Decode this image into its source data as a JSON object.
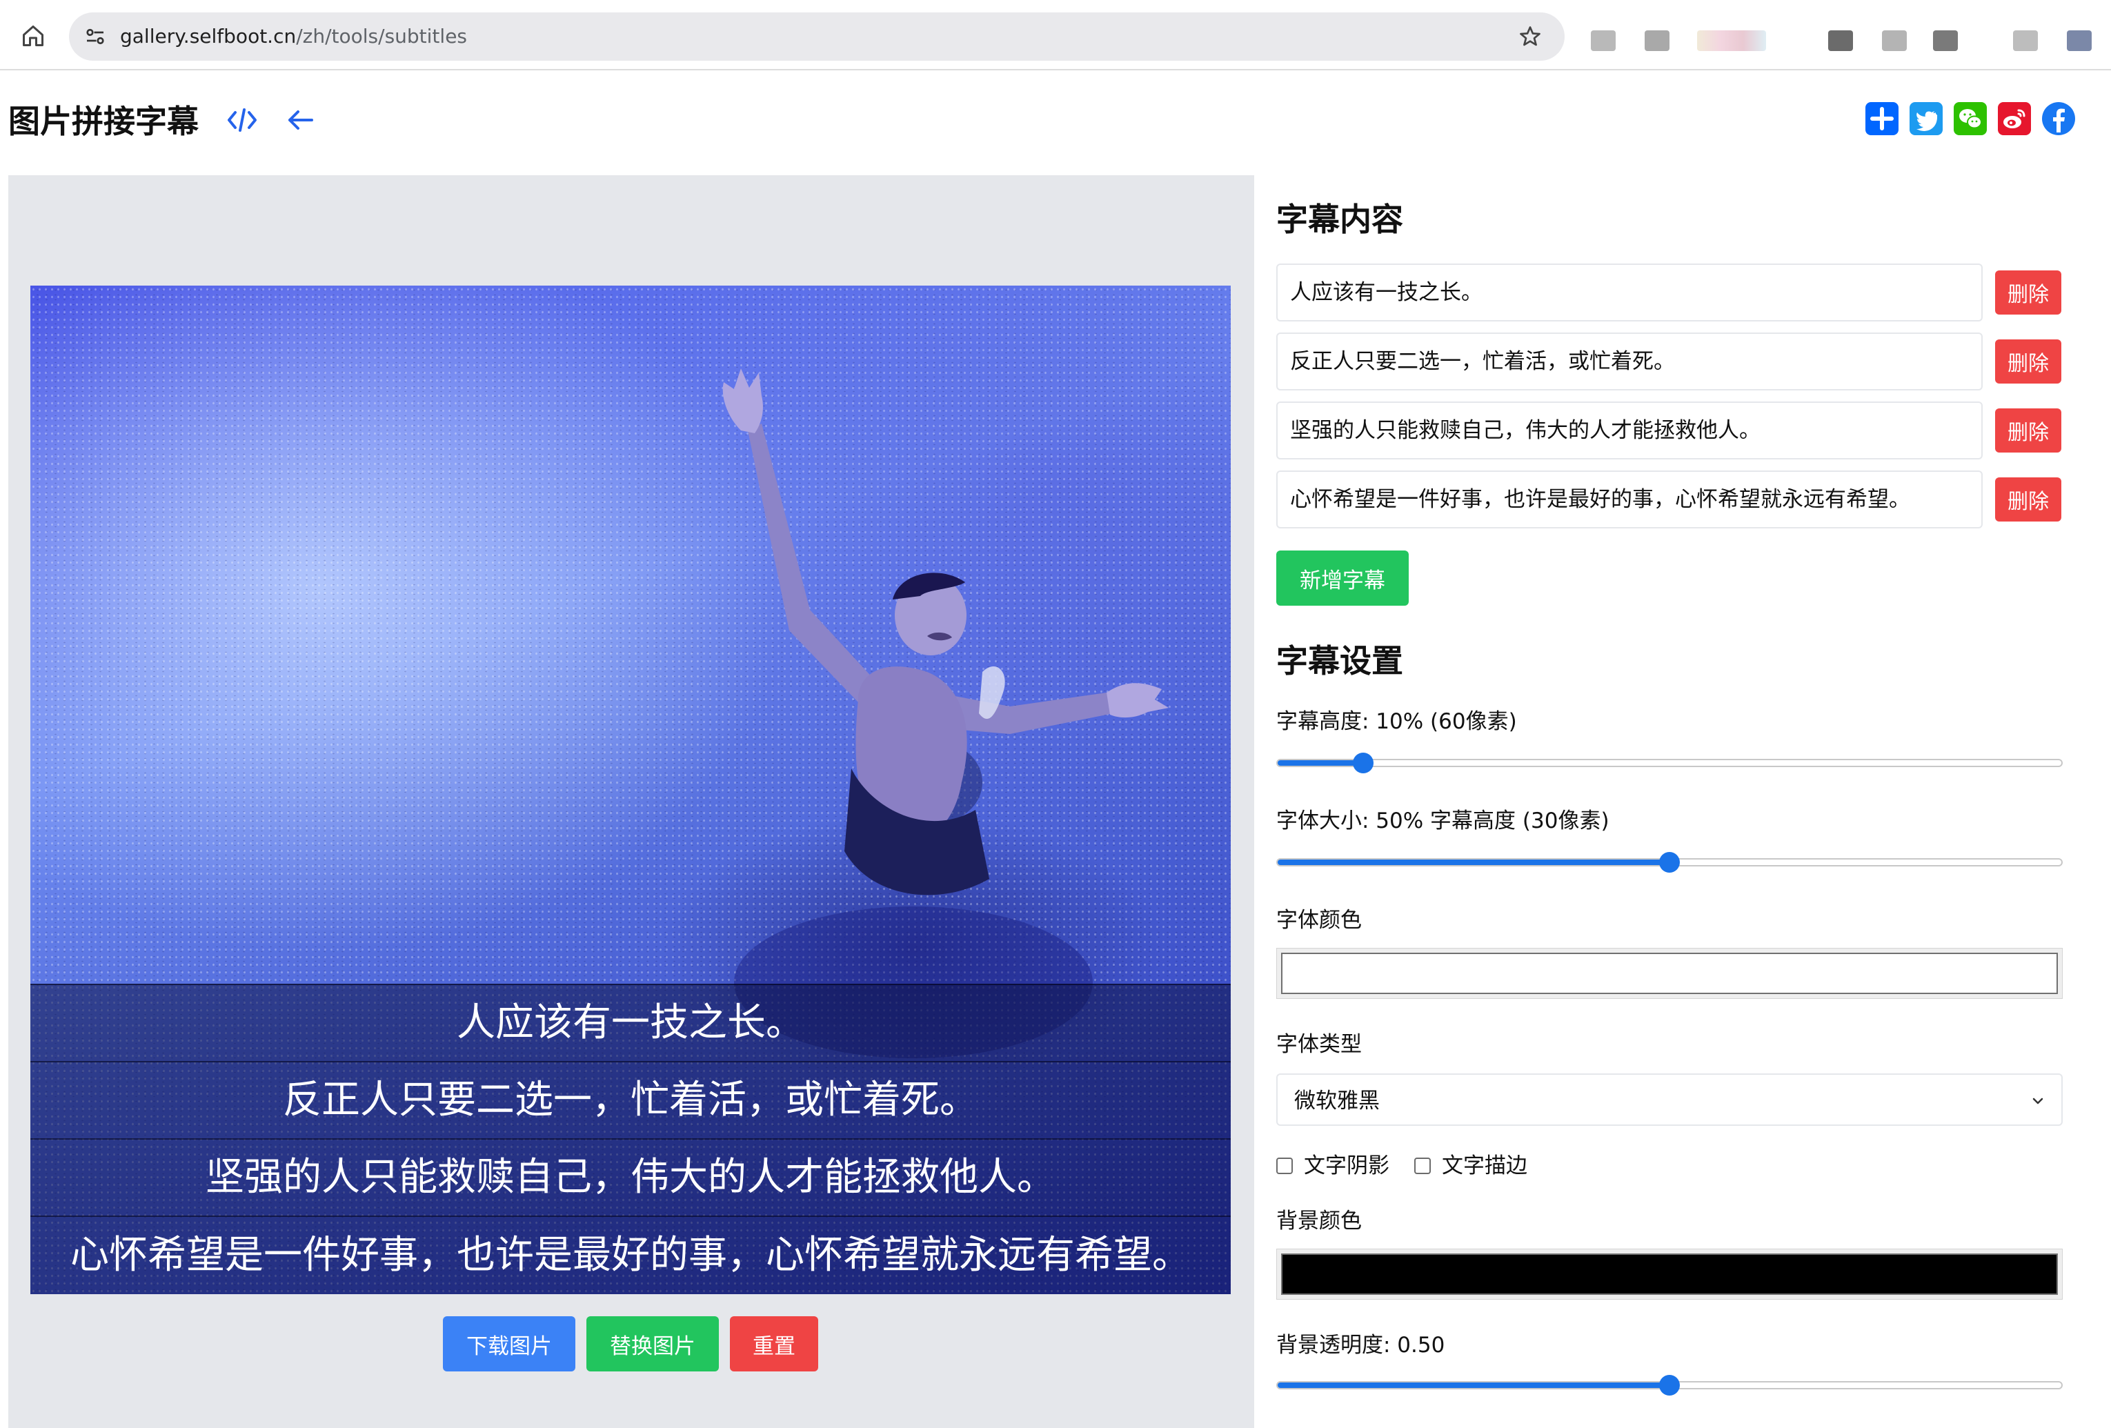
{
  "browser": {
    "url_host": "gallery.selfboot.cn",
    "url_path": "/zh/tools/subtitles"
  },
  "header": {
    "title": "图片拼接字幕"
  },
  "preview": {
    "subtitles": [
      "人应该有一技之长。",
      "反正人只要二选一，忙着活，或忙着死。",
      "坚强的人只能救赎自己，伟大的人才能拯救他人。",
      "心怀希望是一件好事，也许是最好的事，心怀希望就永远有希望。"
    ],
    "download_label": "下载图片",
    "replace_label": "替换图片",
    "reset_label": "重置"
  },
  "content": {
    "title": "字幕内容",
    "items": [
      "人应该有一技之长。",
      "反正人只要二选一，忙着活，或忙着死。",
      "坚强的人只能救赎自己，伟大的人才能拯救他人。",
      "心怀希望是一件好事，也许是最好的事，心怀希望就永远有希望。"
    ],
    "delete_label": "删除",
    "add_label": "新增字幕"
  },
  "settings": {
    "title": "字幕设置",
    "height_label": "字幕高度: 10% (60像素)",
    "height_value": 0.1,
    "font_size_label": "字体大小: 50% 字幕高度 (30像素)",
    "font_size_value": 0.5,
    "font_color_label": "字体颜色",
    "font_color": "#ffffff",
    "font_type_label": "字体类型",
    "font_type_value": "微软雅黑",
    "shadow_label": "文字阴影",
    "shadow_checked": false,
    "stroke_label": "文字描边",
    "stroke_checked": false,
    "bg_color_label": "背景颜色",
    "bg_color": "#000000",
    "bg_opacity_label": "背景透明度: 0.50",
    "bg_opacity_value": 0.5
  },
  "colors": {
    "blue": "#3b82f6",
    "green": "#22c55e",
    "red": "#ef4444",
    "slider": "#1a73e8"
  },
  "icons": {
    "home": "home-icon",
    "site_info": "site-settings-icon",
    "bookmark": "star-icon",
    "code": "code-icon",
    "back": "arrow-left-icon",
    "share": [
      "add-share-icon",
      "twitter-icon",
      "wechat-icon",
      "weibo-icon",
      "facebook-icon"
    ]
  }
}
